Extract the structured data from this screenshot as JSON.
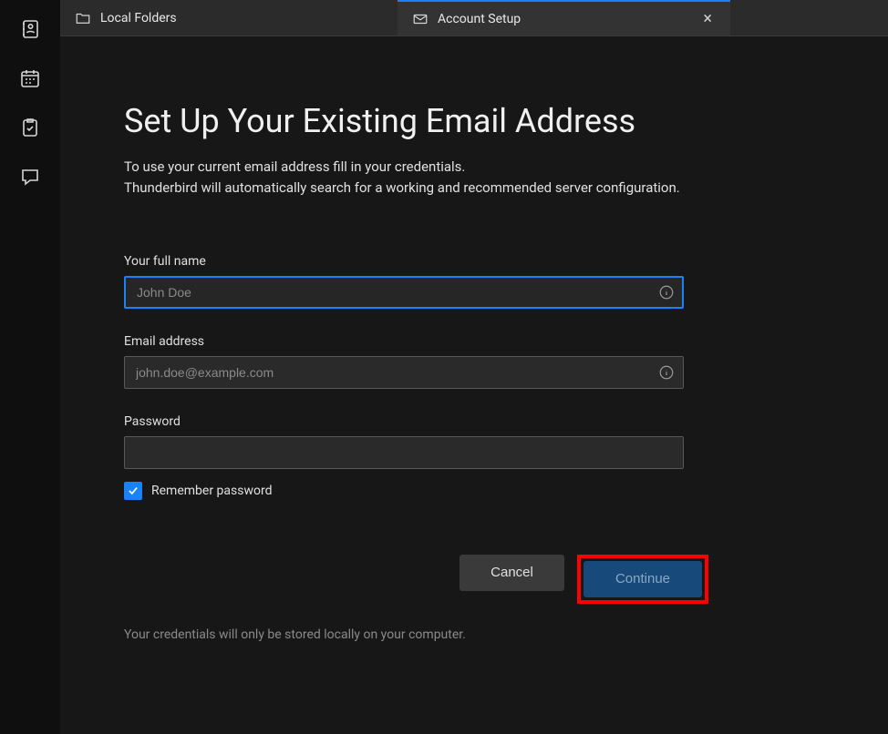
{
  "sidebar": {
    "icons": [
      "address-book",
      "calendar",
      "tasks",
      "chat"
    ]
  },
  "tabs": [
    {
      "label": "Local Folders",
      "icon": "folder",
      "active": false,
      "closable": false
    },
    {
      "label": "Account Setup",
      "icon": "mail-setup",
      "active": true,
      "closable": true
    }
  ],
  "page": {
    "title": "Set Up Your Existing Email Address",
    "description_line1": "To use your current email address fill in your credentials.",
    "description_line2": "Thunderbird will automatically search for a working and recommended server configuration."
  },
  "form": {
    "full_name": {
      "label": "Your full name",
      "placeholder": "John Doe",
      "value": ""
    },
    "email": {
      "label": "Email address",
      "placeholder": "john.doe@example.com",
      "value": ""
    },
    "password": {
      "label": "Password",
      "placeholder": "",
      "value": ""
    },
    "remember": {
      "label": "Remember password",
      "checked": true
    }
  },
  "buttons": {
    "cancel": "Cancel",
    "continue": "Continue"
  },
  "footer_note": "Your credentials will only be stored locally on your computer."
}
